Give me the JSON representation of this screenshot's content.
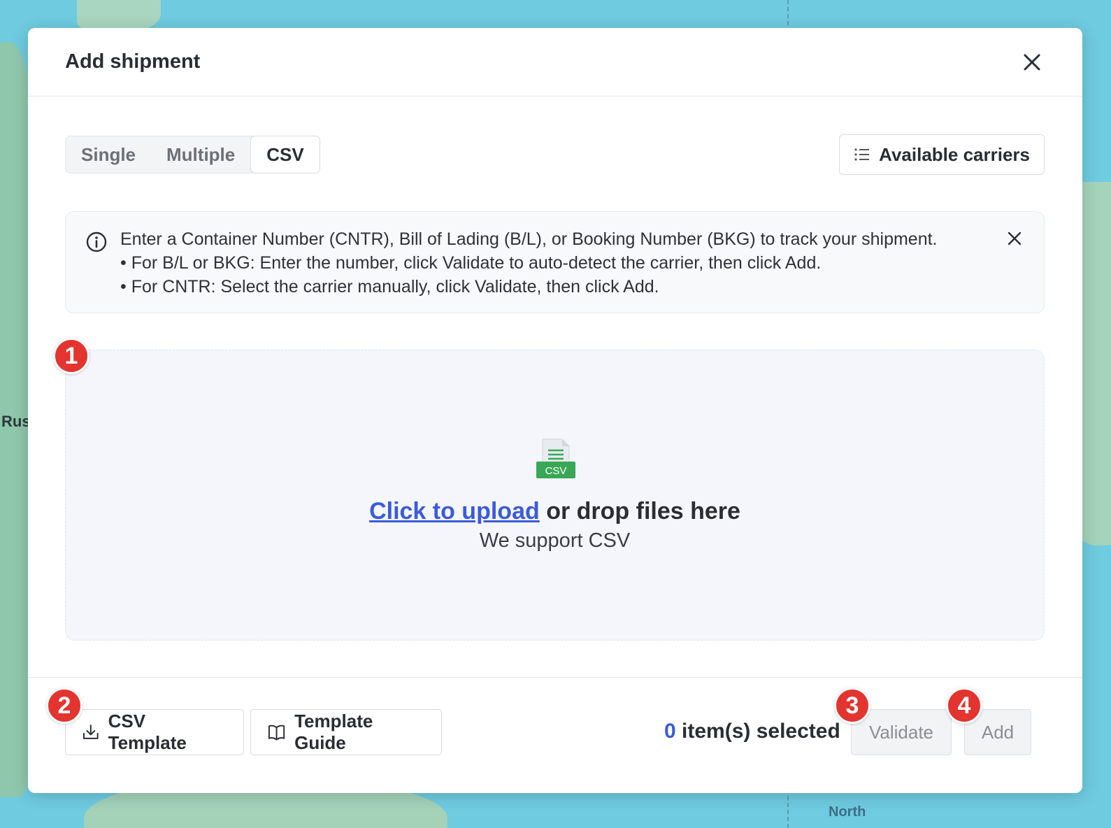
{
  "map": {
    "label_left": "Rus",
    "label_bottom": "North"
  },
  "modal": {
    "title": "Add shipment",
    "tabs": [
      {
        "label": "Single",
        "active": false
      },
      {
        "label": "Multiple",
        "active": false
      },
      {
        "label": "CSV",
        "active": true
      }
    ],
    "carriers_button": {
      "label": "Available carriers",
      "icon": "list-icon"
    },
    "info": {
      "icon": "info-icon",
      "line1": "Enter a Container Number (CNTR), Bill of Lading (B/L), or Booking Number (BKG) to track your shipment.",
      "line2": "• For B/L or BKG: Enter the number, click Validate to auto-detect the carrier, then click Add.",
      "line3": "• For CNTR: Select the carrier manually, click Validate, then click Add."
    },
    "dropzone": {
      "icon_label": "CSV",
      "upload_link": "Click to upload",
      "drop_text": " or drop files here",
      "support_text": "We support CSV"
    },
    "footer": {
      "csv_template": "CSV Template",
      "template_guide": "Template Guide",
      "selected_count": "0",
      "selected_suffix": "item(s) selected",
      "validate": "Validate",
      "add": "Add"
    }
  },
  "markers": [
    "1",
    "2",
    "3",
    "4"
  ],
  "colors": {
    "accent": "#3b5bdb",
    "marker": "#e3342f",
    "csv_green": "#3aa757"
  }
}
